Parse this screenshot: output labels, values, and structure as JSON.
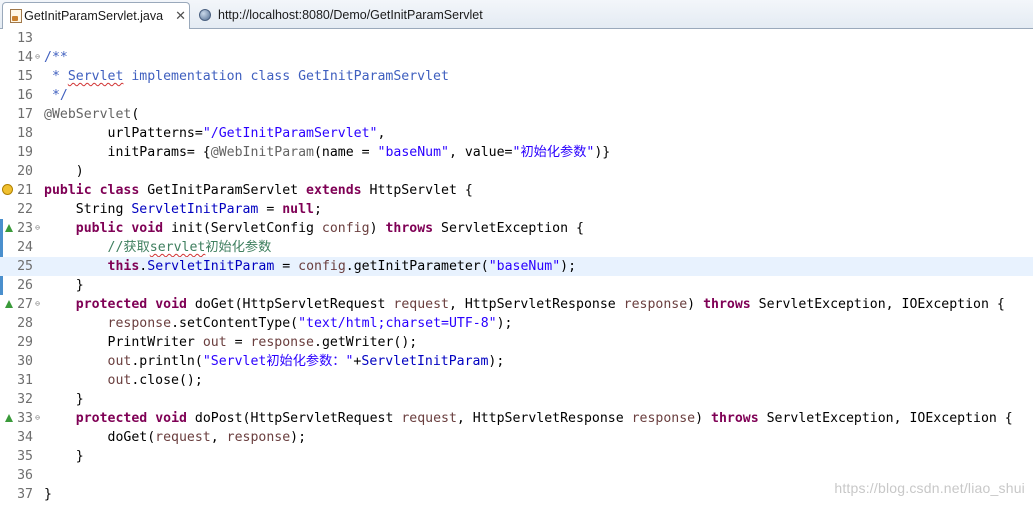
{
  "tabs": [
    {
      "label": "GetInitParamServlet.java",
      "icon": "java-file-icon",
      "active": true
    },
    {
      "label": "http://localhost:8080/Demo/GetInitParamServlet",
      "icon": "globe-icon",
      "active": false
    }
  ],
  "close_glyph": "✕",
  "editor": {
    "current_line": 25,
    "lines": [
      {
        "n": "13"
      },
      {
        "n": "14",
        "fold": "⊖"
      },
      {
        "n": "15"
      },
      {
        "n": "16"
      },
      {
        "n": "17"
      },
      {
        "n": "18"
      },
      {
        "n": "19"
      },
      {
        "n": "20"
      },
      {
        "n": "21"
      },
      {
        "n": "22"
      },
      {
        "n": "23",
        "fold": "⊖"
      },
      {
        "n": "24"
      },
      {
        "n": "25"
      },
      {
        "n": "26"
      },
      {
        "n": "27",
        "fold": "⊖"
      },
      {
        "n": "28"
      },
      {
        "n": "29"
      },
      {
        "n": "30"
      },
      {
        "n": "31"
      },
      {
        "n": "32"
      },
      {
        "n": "33",
        "fold": "⊖"
      },
      {
        "n": "34"
      },
      {
        "n": "35"
      },
      {
        "n": "36"
      },
      {
        "n": "37"
      }
    ],
    "code": {
      "l14_comment": "/**",
      "l15_star": " * ",
      "l15_word": "Servlet",
      "l15_rest": " implementation class GetInitParamServlet",
      "l16_end": " */",
      "l17_annotation": "@WebServlet",
      "l17_paren": "(",
      "l18_indent": "        ",
      "l18_key": "urlPatterns=",
      "l18_value": "\"/GetInitParamServlet\"",
      "l18_comma": ",",
      "l19_indent": "        ",
      "l19_key": "initParams= {",
      "l19_annotation": "@WebInitParam",
      "l19_name_key": "(name = ",
      "l19_name_val": "\"baseNum\"",
      "l19_value_key": ", value=",
      "l19_value_val": "\"初始化参数\"",
      "l19_close": ")}",
      "l20_indent": "    ",
      "l20_close": ")",
      "l21_public": "public",
      "l21_class": "class",
      "l21_name": " GetInitParamServlet ",
      "l21_extends": "extends",
      "l21_super": " HttpServlet {",
      "l22_indent": "    ",
      "l22_type": "String ",
      "l22_field": "ServletInitParam",
      "l22_eq": " = ",
      "l22_null": "null",
      "l22_semi": ";",
      "l23_indent": "    ",
      "l23_public": "public",
      "l23_void": "void",
      "l23_sig": " init(ServletConfig ",
      "l23_param": "config",
      "l23_close": ") ",
      "l23_throws": "throws",
      "l23_exc": " ServletException {",
      "l24_indent": "        ",
      "l24_comment_a": "//获取",
      "l24_comment_b": "servlet",
      "l24_comment_c": "初始化参数",
      "l25_indent": "        ",
      "l25_this": "this",
      "l25_dot": ".",
      "l25_field": "ServletInitParam",
      "l25_eq": " = ",
      "l25_var": "config",
      "l25_call": ".getInitParameter(",
      "l25_arg": "\"baseNum\"",
      "l25_end": ");",
      "l26_close": "    }",
      "l27_indent": "    ",
      "l27_protected": "protected",
      "l27_void": "void",
      "l27_sig_a": " doGet(HttpServletRequest ",
      "l27_req": "request",
      "l27_sig_b": ", HttpServletResponse ",
      "l27_resp": "response",
      "l27_sig_c": ") ",
      "l27_throws": "throws",
      "l27_exc": " ServletException, IOException {",
      "l28_indent": "        ",
      "l28_var": "response",
      "l28_call": ".setContentType(",
      "l28_arg": "\"text/html;charset=UTF-8\"",
      "l28_end": ");",
      "l29_indent": "        ",
      "l29_type": "PrintWriter ",
      "l29_var": "out",
      "l29_eq": " = ",
      "l29_resp": "response",
      "l29_call": ".getWriter();",
      "l30_indent": "        ",
      "l30_var": "out",
      "l30_call": ".println(",
      "l30_arg": "\"Servlet初始化参数：\"",
      "l30_plus": "+",
      "l30_field": "ServletInitParam",
      "l30_end": ");",
      "l31_indent": "        ",
      "l31_var": "out",
      "l31_call": ".close();",
      "l32_close": "    }",
      "l33_indent": "    ",
      "l33_protected": "protected",
      "l33_void": "void",
      "l33_sig_a": " doPost(HttpServletRequest ",
      "l33_req": "request",
      "l33_sig_b": ", HttpServletResponse ",
      "l33_resp": "response",
      "l33_sig_c": ") ",
      "l33_throws": "throws",
      "l33_exc": " ServletException, IOException {",
      "l34_indent": "        ",
      "l34_call": "doGet(",
      "l34_req": "request",
      "l34_comma": ", ",
      "l34_resp": "response",
      "l34_end": ");",
      "l35_close": "    }",
      "l37_close": "}"
    }
  },
  "watermark": "https://blog.csdn.net/liao_shui"
}
